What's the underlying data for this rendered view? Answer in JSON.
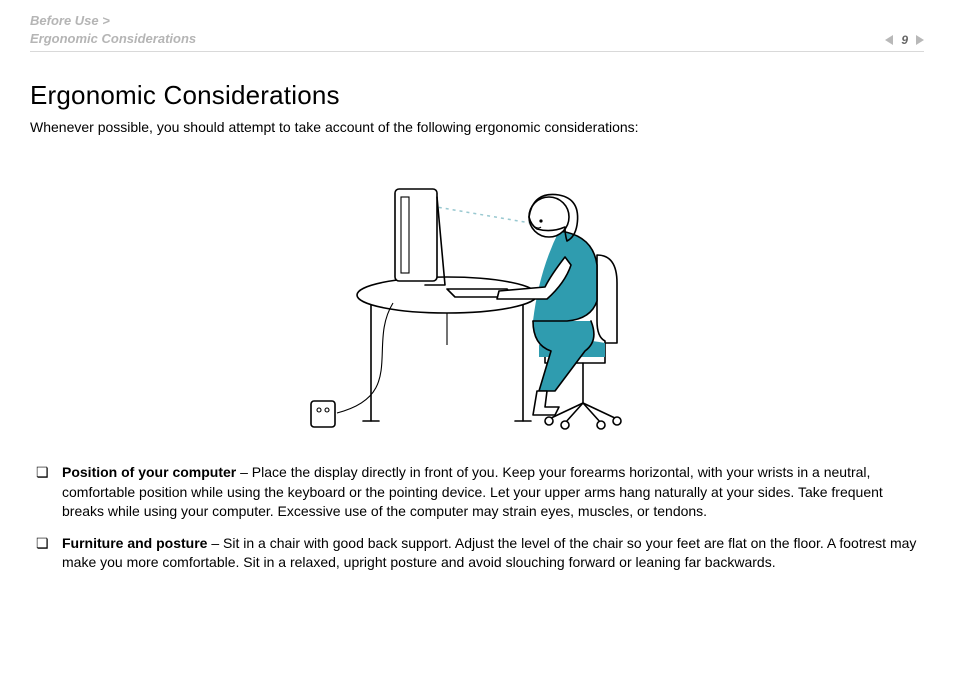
{
  "breadcrumb": {
    "parent": "Before Use",
    "current": "Ergonomic Considerations"
  },
  "page_number": "9",
  "heading": "Ergonomic Considerations",
  "intro": "Whenever possible, you should attempt to take account of the following ergonomic considerations:",
  "bullets": [
    {
      "title": "Position of your computer",
      "body": " – Place the display directly in front of you. Keep your forearms horizontal, with your wrists in a neutral, comfortable position while using the keyboard or the pointing device. Let your upper arms hang naturally at your sides. Take frequent breaks while using your computer. Excessive use of the computer may strain eyes, muscles, or tendons."
    },
    {
      "title": "Furniture and posture",
      "body": " – Sit in a chair with good back support. Adjust the level of the chair so your feet are flat on the floor. A footrest may make you more comfortable. Sit in a relaxed, upright posture and avoid slouching forward or leaning far backwards."
    }
  ],
  "accent_color": "#2f9caf"
}
